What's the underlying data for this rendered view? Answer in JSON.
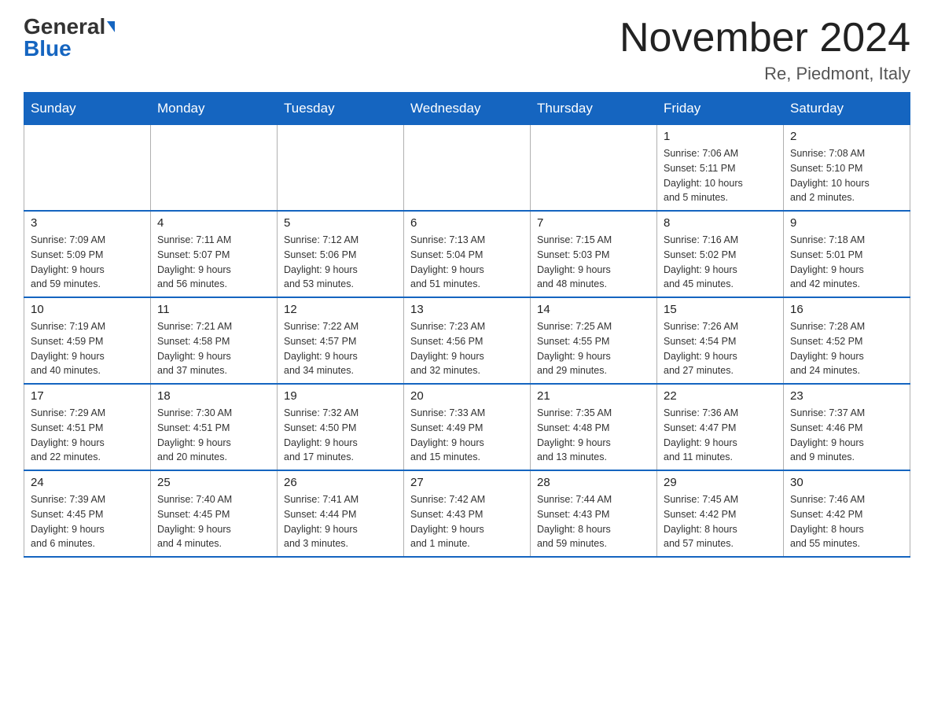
{
  "logo": {
    "general": "General",
    "blue": "Blue"
  },
  "header": {
    "month_year": "November 2024",
    "location": "Re, Piedmont, Italy"
  },
  "weekdays": [
    "Sunday",
    "Monday",
    "Tuesday",
    "Wednesday",
    "Thursday",
    "Friday",
    "Saturday"
  ],
  "weeks": [
    [
      {
        "day": "",
        "info": ""
      },
      {
        "day": "",
        "info": ""
      },
      {
        "day": "",
        "info": ""
      },
      {
        "day": "",
        "info": ""
      },
      {
        "day": "",
        "info": ""
      },
      {
        "day": "1",
        "info": "Sunrise: 7:06 AM\nSunset: 5:11 PM\nDaylight: 10 hours\nand 5 minutes."
      },
      {
        "day": "2",
        "info": "Sunrise: 7:08 AM\nSunset: 5:10 PM\nDaylight: 10 hours\nand 2 minutes."
      }
    ],
    [
      {
        "day": "3",
        "info": "Sunrise: 7:09 AM\nSunset: 5:09 PM\nDaylight: 9 hours\nand 59 minutes."
      },
      {
        "day": "4",
        "info": "Sunrise: 7:11 AM\nSunset: 5:07 PM\nDaylight: 9 hours\nand 56 minutes."
      },
      {
        "day": "5",
        "info": "Sunrise: 7:12 AM\nSunset: 5:06 PM\nDaylight: 9 hours\nand 53 minutes."
      },
      {
        "day": "6",
        "info": "Sunrise: 7:13 AM\nSunset: 5:04 PM\nDaylight: 9 hours\nand 51 minutes."
      },
      {
        "day": "7",
        "info": "Sunrise: 7:15 AM\nSunset: 5:03 PM\nDaylight: 9 hours\nand 48 minutes."
      },
      {
        "day": "8",
        "info": "Sunrise: 7:16 AM\nSunset: 5:02 PM\nDaylight: 9 hours\nand 45 minutes."
      },
      {
        "day": "9",
        "info": "Sunrise: 7:18 AM\nSunset: 5:01 PM\nDaylight: 9 hours\nand 42 minutes."
      }
    ],
    [
      {
        "day": "10",
        "info": "Sunrise: 7:19 AM\nSunset: 4:59 PM\nDaylight: 9 hours\nand 40 minutes."
      },
      {
        "day": "11",
        "info": "Sunrise: 7:21 AM\nSunset: 4:58 PM\nDaylight: 9 hours\nand 37 minutes."
      },
      {
        "day": "12",
        "info": "Sunrise: 7:22 AM\nSunset: 4:57 PM\nDaylight: 9 hours\nand 34 minutes."
      },
      {
        "day": "13",
        "info": "Sunrise: 7:23 AM\nSunset: 4:56 PM\nDaylight: 9 hours\nand 32 minutes."
      },
      {
        "day": "14",
        "info": "Sunrise: 7:25 AM\nSunset: 4:55 PM\nDaylight: 9 hours\nand 29 minutes."
      },
      {
        "day": "15",
        "info": "Sunrise: 7:26 AM\nSunset: 4:54 PM\nDaylight: 9 hours\nand 27 minutes."
      },
      {
        "day": "16",
        "info": "Sunrise: 7:28 AM\nSunset: 4:52 PM\nDaylight: 9 hours\nand 24 minutes."
      }
    ],
    [
      {
        "day": "17",
        "info": "Sunrise: 7:29 AM\nSunset: 4:51 PM\nDaylight: 9 hours\nand 22 minutes."
      },
      {
        "day": "18",
        "info": "Sunrise: 7:30 AM\nSunset: 4:51 PM\nDaylight: 9 hours\nand 20 minutes."
      },
      {
        "day": "19",
        "info": "Sunrise: 7:32 AM\nSunset: 4:50 PM\nDaylight: 9 hours\nand 17 minutes."
      },
      {
        "day": "20",
        "info": "Sunrise: 7:33 AM\nSunset: 4:49 PM\nDaylight: 9 hours\nand 15 minutes."
      },
      {
        "day": "21",
        "info": "Sunrise: 7:35 AM\nSunset: 4:48 PM\nDaylight: 9 hours\nand 13 minutes."
      },
      {
        "day": "22",
        "info": "Sunrise: 7:36 AM\nSunset: 4:47 PM\nDaylight: 9 hours\nand 11 minutes."
      },
      {
        "day": "23",
        "info": "Sunrise: 7:37 AM\nSunset: 4:46 PM\nDaylight: 9 hours\nand 9 minutes."
      }
    ],
    [
      {
        "day": "24",
        "info": "Sunrise: 7:39 AM\nSunset: 4:45 PM\nDaylight: 9 hours\nand 6 minutes."
      },
      {
        "day": "25",
        "info": "Sunrise: 7:40 AM\nSunset: 4:45 PM\nDaylight: 9 hours\nand 4 minutes."
      },
      {
        "day": "26",
        "info": "Sunrise: 7:41 AM\nSunset: 4:44 PM\nDaylight: 9 hours\nand 3 minutes."
      },
      {
        "day": "27",
        "info": "Sunrise: 7:42 AM\nSunset: 4:43 PM\nDaylight: 9 hours\nand 1 minute."
      },
      {
        "day": "28",
        "info": "Sunrise: 7:44 AM\nSunset: 4:43 PM\nDaylight: 8 hours\nand 59 minutes."
      },
      {
        "day": "29",
        "info": "Sunrise: 7:45 AM\nSunset: 4:42 PM\nDaylight: 8 hours\nand 57 minutes."
      },
      {
        "day": "30",
        "info": "Sunrise: 7:46 AM\nSunset: 4:42 PM\nDaylight: 8 hours\nand 55 minutes."
      }
    ]
  ]
}
